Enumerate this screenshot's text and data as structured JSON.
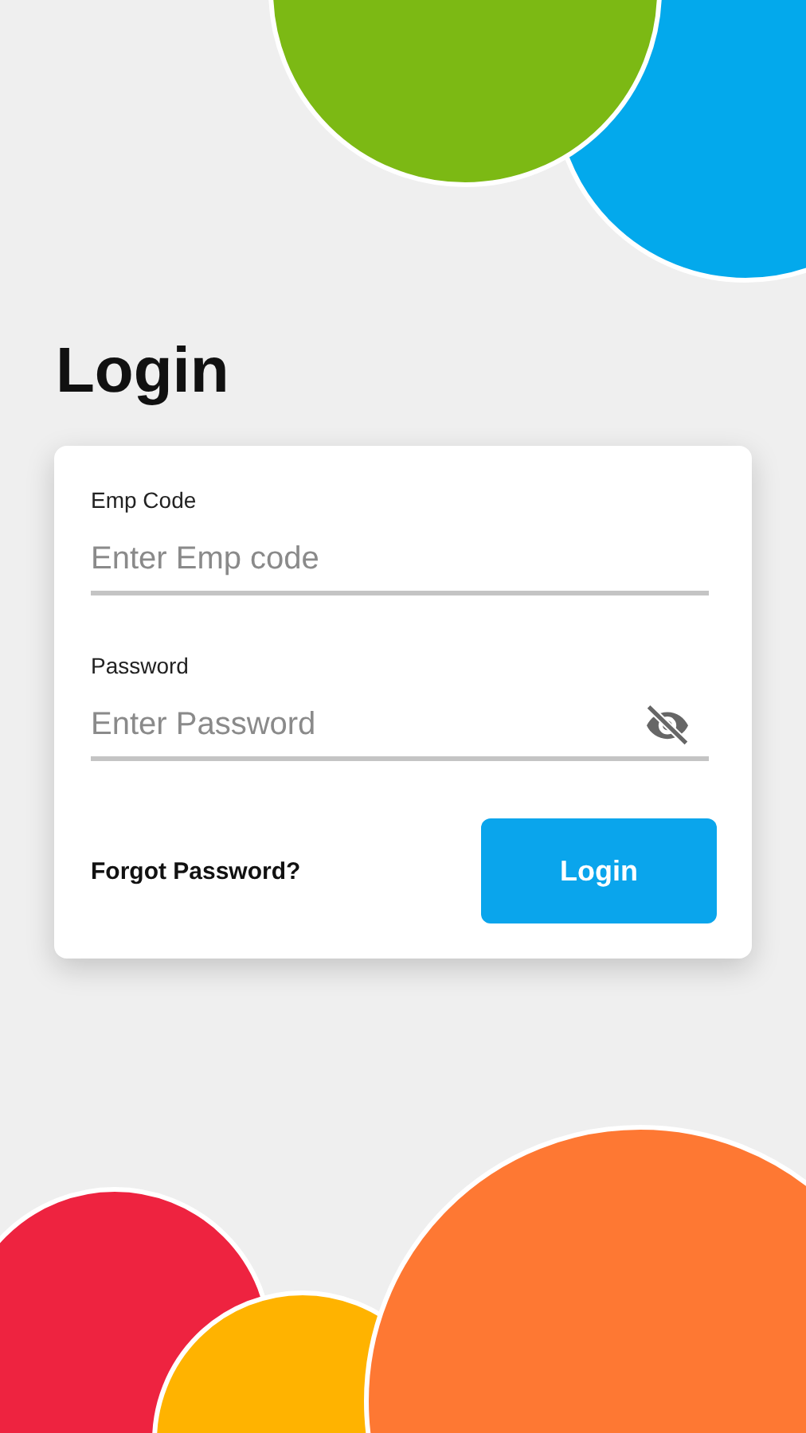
{
  "title": "Login",
  "fields": [
    {
      "kind": "text",
      "label": "Emp Code",
      "placeholder": "Enter Emp code"
    },
    {
      "kind": "password",
      "label": "Password",
      "placeholder": "Enter Password"
    }
  ],
  "forgot_link": "Forgot Password?",
  "login_button": "Login"
}
